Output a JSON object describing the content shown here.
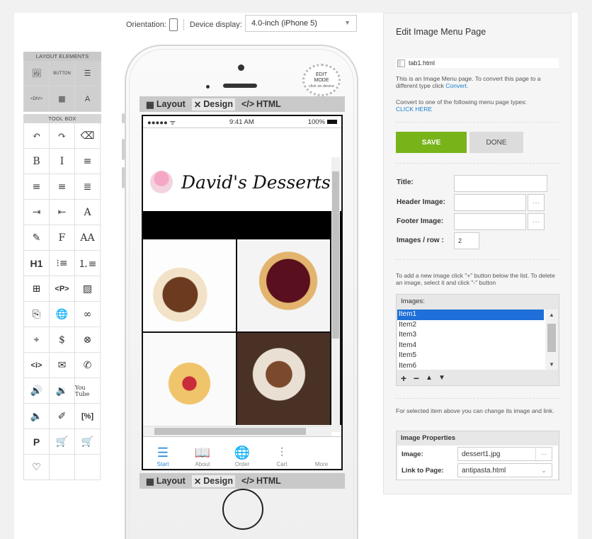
{
  "toolbar": {
    "orientation_label": "Orientation:",
    "device_label": "Device display:",
    "device_value": "4.0-inch (iPhone 5)"
  },
  "palette": {
    "layout_heading": "LAYOUT ELEMENTS",
    "layout_items": [
      {
        "icon": "image-icon",
        "glyph": "🖼"
      },
      {
        "icon": "button-icon",
        "glyph": "BUTTON"
      },
      {
        "icon": "list-icon",
        "glyph": "☰"
      },
      {
        "icon": "div-icon",
        "glyph": "<DIV>"
      },
      {
        "icon": "table-icon",
        "glyph": "▦"
      },
      {
        "icon": "text-icon",
        "glyph": "A"
      }
    ],
    "toolbox_heading": "TOOL BOX",
    "tools": [
      {
        "icon": "undo-icon",
        "glyph": "↶"
      },
      {
        "icon": "redo-icon",
        "glyph": "↷"
      },
      {
        "icon": "eraser-icon",
        "glyph": "⌫"
      },
      {
        "icon": "bold-icon",
        "glyph": "B"
      },
      {
        "icon": "italic-icon",
        "glyph": "I"
      },
      {
        "icon": "align-left-icon",
        "glyph": "≡"
      },
      {
        "icon": "align-center-icon",
        "glyph": "≡"
      },
      {
        "icon": "align-right-icon",
        "glyph": "≡"
      },
      {
        "icon": "justify-icon",
        "glyph": "≣"
      },
      {
        "icon": "indent-icon",
        "glyph": "⇥"
      },
      {
        "icon": "outdent-icon",
        "glyph": "⇤"
      },
      {
        "icon": "font-color-icon",
        "glyph": "A"
      },
      {
        "icon": "highlight-icon",
        "glyph": "✎"
      },
      {
        "icon": "font-family-icon",
        "glyph": "F"
      },
      {
        "icon": "font-size-icon",
        "glyph": "AA"
      },
      {
        "icon": "heading-icon",
        "glyph": "H1"
      },
      {
        "icon": "bullet-list-icon",
        "glyph": "⁝≡"
      },
      {
        "icon": "numbered-list-icon",
        "glyph": "⒈≡"
      },
      {
        "icon": "insert-table-icon",
        "glyph": "⊞"
      },
      {
        "icon": "paragraph-icon",
        "glyph": "<P>"
      },
      {
        "icon": "insert-image-icon",
        "glyph": "▨"
      },
      {
        "icon": "file-link-icon",
        "glyph": "⎘"
      },
      {
        "icon": "web-link-icon",
        "glyph": "🌐"
      },
      {
        "icon": "link-icon",
        "glyph": "∞"
      },
      {
        "icon": "map-icon",
        "glyph": "⌖"
      },
      {
        "icon": "payment-icon",
        "glyph": "$"
      },
      {
        "icon": "unlink-icon",
        "glyph": "⊗"
      },
      {
        "icon": "code-icon",
        "glyph": "<i>"
      },
      {
        "icon": "email-icon",
        "glyph": "✉"
      },
      {
        "icon": "phone-call-icon",
        "glyph": "✆"
      },
      {
        "icon": "audio-mp3-icon",
        "glyph": "🔊"
      },
      {
        "icon": "audio-icon",
        "glyph": "🔉"
      },
      {
        "icon": "youtube-icon",
        "glyph": "You Tube"
      },
      {
        "icon": "audio-wav-icon",
        "glyph": "🔈"
      },
      {
        "icon": "form-icon",
        "glyph": "✐"
      },
      {
        "icon": "percent-icon",
        "glyph": "[%]"
      },
      {
        "icon": "paypal-icon",
        "glyph": "P"
      },
      {
        "icon": "add-to-cart-icon",
        "glyph": "🛒"
      },
      {
        "icon": "cart-upload-icon",
        "glyph": "🛒"
      },
      {
        "icon": "favorite-add-icon",
        "glyph": "♡"
      }
    ]
  },
  "phone": {
    "badge_line1": "EDIT",
    "badge_line2": "MODE",
    "badge_line3": "click on device",
    "tabs": {
      "layout": "Layout",
      "design": "Design",
      "html": "HTML"
    },
    "status": {
      "signal": "●●●●● ᯤ",
      "time": "9:41 AM",
      "battery": "100%"
    },
    "brand_title": "David's Desserts",
    "nav": [
      {
        "label": "Start",
        "glyph": "☰",
        "icon": "start-icon",
        "active": true
      },
      {
        "label": "About",
        "glyph": "📖",
        "icon": "about-icon",
        "active": false
      },
      {
        "label": "Order",
        "glyph": "🌐",
        "icon": "order-icon",
        "active": false
      },
      {
        "label": "Cart",
        "glyph": "⫶",
        "icon": "cart-icon",
        "active": false
      },
      {
        "label": "More",
        "glyph": "",
        "icon": "more-icon",
        "active": false
      }
    ]
  },
  "panel": {
    "title": "Edit Image Menu Page",
    "filename": "tab1.html",
    "info_text": "This is an Image Menu page. To convert this page to a different type click ",
    "convert_link": "Convert.",
    "convert_text": "Convert to one of the following menu page types:",
    "click_here": "CLICK HERE",
    "save": "SAVE",
    "done": "DONE",
    "title_label": "Title:",
    "header_label": "Header Image:",
    "footer_label": "Footer Image:",
    "perrow_label": "Images / row :",
    "perrow_value": "2",
    "title_value": "",
    "header_value": "",
    "footer_value": "",
    "dots": "···",
    "add_help": "To add a new image click \"+\" button below the list. To delete an image, select it and click \"-\" button",
    "images_heading": "Images:",
    "images": [
      "Item1",
      "Item2",
      "Item3",
      "Item4",
      "Item5",
      "Item6"
    ],
    "selected_index": 0,
    "selected_help": "For selected item above you can change its image and link.",
    "props_heading": "Image Properties",
    "image_label": "Image:",
    "image_value": "dessert1.jpg",
    "link_label": "Link to Page:",
    "link_value": "antipasta.html"
  }
}
